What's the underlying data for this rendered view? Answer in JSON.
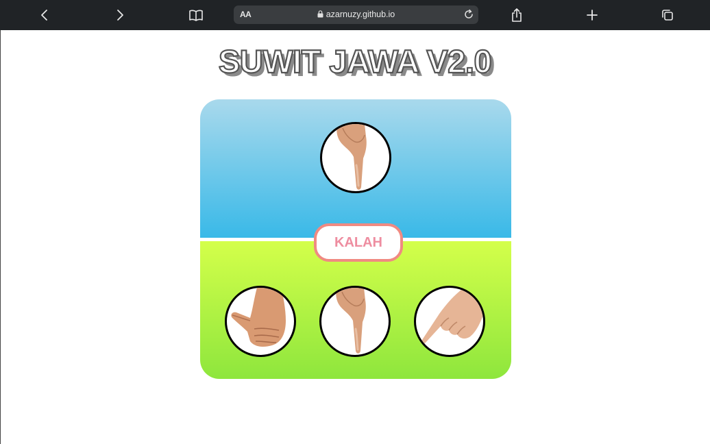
{
  "browser": {
    "reader_label": "AA",
    "url": "azarnuzy.github.io"
  },
  "page": {
    "title": "SUWIT JAWA V2.0",
    "result": "KALAH"
  },
  "opponent_choice": "index-finger-hand-icon",
  "player_choices": [
    "thumb-hand-icon",
    "index-finger-hand-icon",
    "pinky-finger-hand-icon"
  ],
  "colors": {
    "top_gradient": [
      "#a9d9ec",
      "#39b9e8"
    ],
    "bottom_gradient": [
      "#d4ff4a",
      "#8ee63d"
    ],
    "result_border": "#f08a82",
    "result_text": "#ee8da0"
  }
}
